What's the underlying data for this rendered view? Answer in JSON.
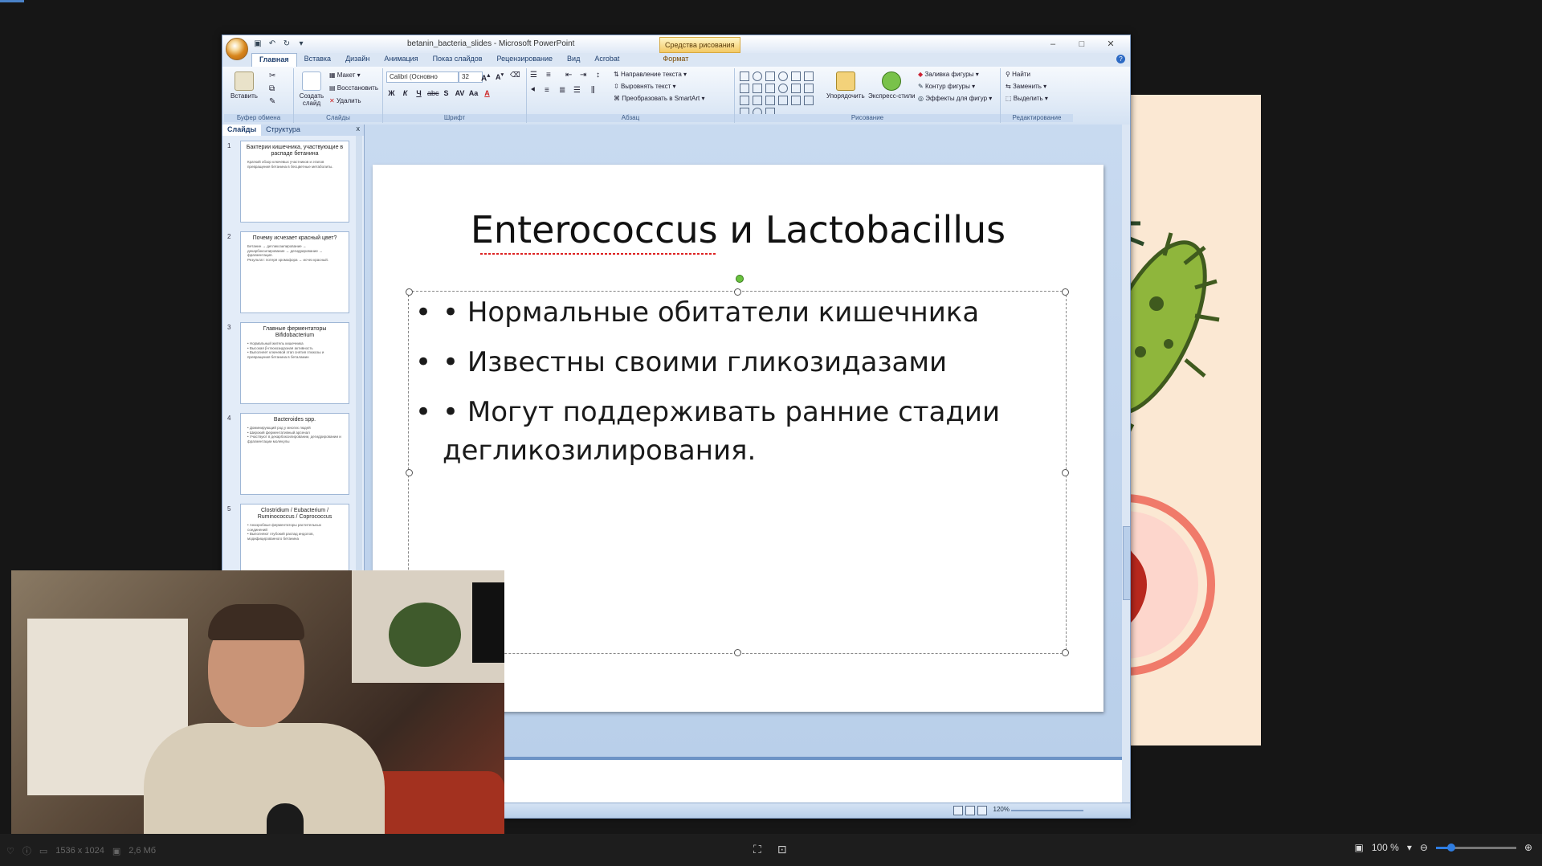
{
  "window": {
    "title": "betanin_bacteria_slides - Microsoft PowerPoint",
    "context_tab_group": "Средства рисования",
    "controls": [
      "–",
      "□",
      "✕"
    ]
  },
  "ribbon": {
    "tabs": [
      "Главная",
      "Вставка",
      "Дизайн",
      "Анимация",
      "Показ слайдов",
      "Рецензирование",
      "Вид",
      "Acrobat",
      "Формат"
    ],
    "help": "?",
    "clipboard": {
      "paste": "Вставить",
      "label": "Буфер обмена"
    },
    "slides": {
      "new_slide": "Создать слайд",
      "layout": "Макет",
      "reset": "Восстановить",
      "delete": "Удалить",
      "label": "Слайды"
    },
    "font": {
      "family": "Calibri (Основно",
      "size": "32",
      "label": "Шрифт",
      "buttons": [
        "Ж",
        "К",
        "Ч",
        "abc",
        "S",
        "AV",
        "Aa",
        "A"
      ]
    },
    "paragraph": {
      "text_direction": "Направление текста",
      "align_text": "Выровнять текст",
      "smartart": "Преобразовать в SmartArt",
      "label": "Абзац"
    },
    "drawing": {
      "arrange": "Упорядочить",
      "quick_styles": "Экспресс-стили",
      "fill": "Заливка фигуры",
      "outline": "Контур фигуры",
      "effects": "Эффекты для фигур",
      "label": "Рисование"
    },
    "editing": {
      "find": "Найти",
      "replace": "Заменить",
      "select": "Выделить",
      "label": "Редактирование"
    }
  },
  "side_pane": {
    "tabs": [
      "Слайды",
      "Структура"
    ],
    "close": "x",
    "slides": [
      {
        "num": "1",
        "title": "Бактерии кишечника, участвующие в распаде бетанина",
        "lines": [
          "Краткий обзор ключевых участников и этапов превращения бетанина в бесцветные метаболиты."
        ]
      },
      {
        "num": "2",
        "title": "Почему исчезает красный цвет?",
        "lines": [
          "Бетанин → дегликозилирование → декарбоксилирование → дегидрирование → фрагментация.",
          "Результат: потеря хромофора → исчез красный."
        ]
      },
      {
        "num": "3",
        "title": "Главные ферментаторы Bifidobacterium",
        "lines": [
          "• Нормальный житель кишечника",
          "• Высокая β-глюкозидазная активность",
          "• Выполняет ключевой этап снятия глюкозы и превращения бетанина в беталамин"
        ]
      },
      {
        "num": "4",
        "title": "Bacteroides spp.",
        "lines": [
          "• Доминирующий род у многих людей",
          "• Широкий ферментативный арсенал",
          "• Участвуют в декарбоксилировании, дегидрировании и фрагментации молекулы"
        ]
      },
      {
        "num": "5",
        "title": "Clostridium / Eubacterium / Ruminococcus / Coprococcus",
        "lines": [
          "• Анаэробные ферментаторы растительных соединений",
          "• Выполняют глубокий распад индолов, модифицированного бетанина"
        ]
      }
    ]
  },
  "slide": {
    "title": "Enterococcus и Lactobacillus",
    "bullets": [
      "• Нормальные обитатели кишечника",
      "• Известны своими гликозидазами",
      "• Могут поддерживать ранние стадии дегликозилирования."
    ]
  },
  "status_bar": {
    "zoom": "120%"
  },
  "viewer": {
    "dimensions": "1536 x 1024",
    "file_size": "2,6 Мб",
    "zoom": "100 %",
    "zoom_level": 0.18
  }
}
